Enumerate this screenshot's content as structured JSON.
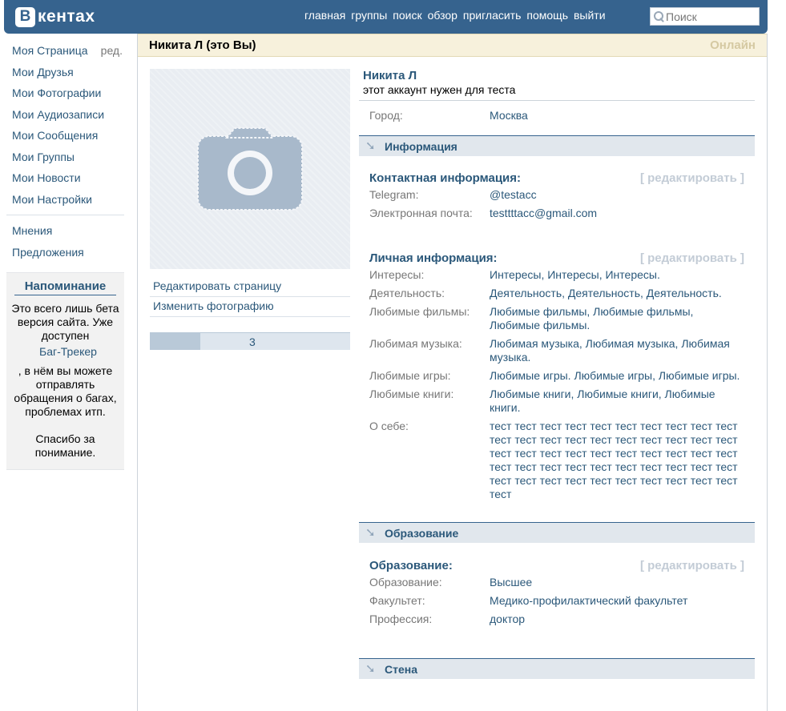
{
  "header": {
    "logo_letter": "В",
    "logo_text": "кентах",
    "nav": [
      "главная",
      "группы",
      "поиск",
      "обзор",
      "пригласить",
      "помощь",
      "выйти"
    ],
    "search_placeholder": "Поиск"
  },
  "sidebar": {
    "items": [
      {
        "label": "Моя Страница"
      },
      {
        "label": "Мои Друзья"
      },
      {
        "label": "Мои Фотографии"
      },
      {
        "label": "Мои Аудиозаписи"
      },
      {
        "label": "Мои Сообщения"
      },
      {
        "label": "Мои Группы"
      },
      {
        "label": "Мои Новости"
      },
      {
        "label": "Мои Настройки"
      }
    ],
    "edit_label": "ред.",
    "extra": [
      {
        "label": "Мнения"
      },
      {
        "label": "Предложения"
      }
    ],
    "reminder": {
      "title": "Напоминание",
      "text1": "Это всего лишь бета версия сайта. Уже доступен ",
      "link": "Баг-Трекер",
      "text2": ", в нём вы можете отправлять обращения о багах, проблемах итп.",
      "text3": "Спасибо за понимание."
    }
  },
  "profile": {
    "title": "Никита Л (это Вы)",
    "online": "Онлайн",
    "actions": [
      "Редактировать страницу",
      "Изменить фотографию"
    ],
    "progress_value": 3,
    "progress_fraction": 0.25,
    "name": "Никита Л",
    "status": "этот аккаунт нужен для теста",
    "city_label": "Город:",
    "city": "Москва",
    "info_title": "Информация",
    "edit_label": "[ редактировать ]",
    "contact": {
      "title": "Контактная информация:",
      "rows": [
        {
          "label": "Telegram:",
          "value": "@testacc"
        },
        {
          "label": "Электронная почта:",
          "value": "testtttacc@gmail.com"
        }
      ]
    },
    "personal": {
      "title": "Личная информация:",
      "rows": [
        {
          "label": "Интересы:",
          "value": "Интересы, Интересы, Интересы."
        },
        {
          "label": "Деятельность:",
          "value": "Деятельность, Деятельность, Деятельность."
        },
        {
          "label": "Любимые фильмы:",
          "value": "Любимые фильмы, Любимые фильмы, Любимые фильмы."
        },
        {
          "label": "Любимая музыка:",
          "value": "Любимая музыка, Любимая музыка, Любимая музыка."
        },
        {
          "label": "Любимые игры:",
          "value": "Любимые игры. Любимые игры, Любимые игры."
        },
        {
          "label": "Любимые книги:",
          "value": "Любимые книги, Любимые книги, Любимые книги."
        },
        {
          "label": "О себе:",
          "value": "тест тест тест тест тест тест тест тест тест тест тест тест тест тест тест тест тест тест тест тест тест тест тест тест тест тест тест тест тест тест тест тест тест тест тест тест тест тест тест тест тест тест тест тест тест тест тест тест тест тест тест"
        }
      ]
    },
    "education_title": "Образование",
    "education": {
      "title": "Образование:",
      "rows": [
        {
          "label": "Образование:",
          "value": "Высшее"
        },
        {
          "label": "Факультет:",
          "value": "Медико-профилактический факультет"
        },
        {
          "label": "Профессия:",
          "value": "доктор"
        }
      ]
    },
    "next_section_title": "Стена"
  }
}
